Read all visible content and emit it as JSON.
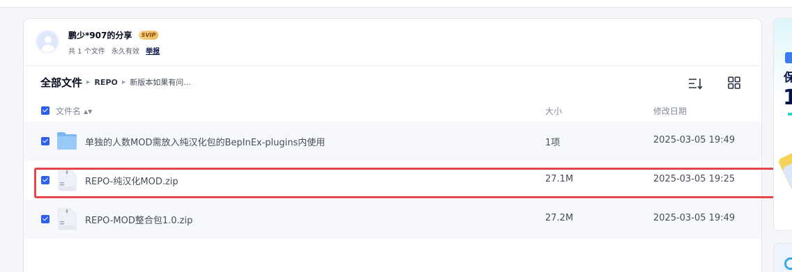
{
  "share": {
    "sharer_name": "鹏少*907的分享",
    "badge": "SVIP",
    "file_count": "共 1 个文件",
    "validity": "永久有效",
    "report": "举报"
  },
  "breadcrumb": {
    "root": "全部文件",
    "items": [
      "REPO",
      "新版本如果有问..."
    ]
  },
  "columns": {
    "name": "文件名",
    "size": "大小",
    "date": "修改日期"
  },
  "files": [
    {
      "name": "单独的人数MOD需放入纯汉化包的BepInEx-plugins内使用",
      "size": "1项",
      "date": "2025-03-05 19:49",
      "type": "folder-icon",
      "checked": true
    },
    {
      "name": "REPO-纯汉化MOD.zip",
      "size": "27.1M",
      "date": "2025-03-05 19:25",
      "type": "zip-file-icon",
      "checked": true
    },
    {
      "name": "REPO-MOD整合包1.0.zip",
      "size": "27.2M",
      "date": "2025-03-05 19:49",
      "type": "zip-file-icon",
      "checked": true
    }
  ],
  "side_panel": {
    "text_a": "保",
    "text_b": "1"
  },
  "colors": {
    "accent": "#2e5ff5",
    "highlight_box": "#e9434a",
    "row_bg": "#f7f8fb"
  }
}
